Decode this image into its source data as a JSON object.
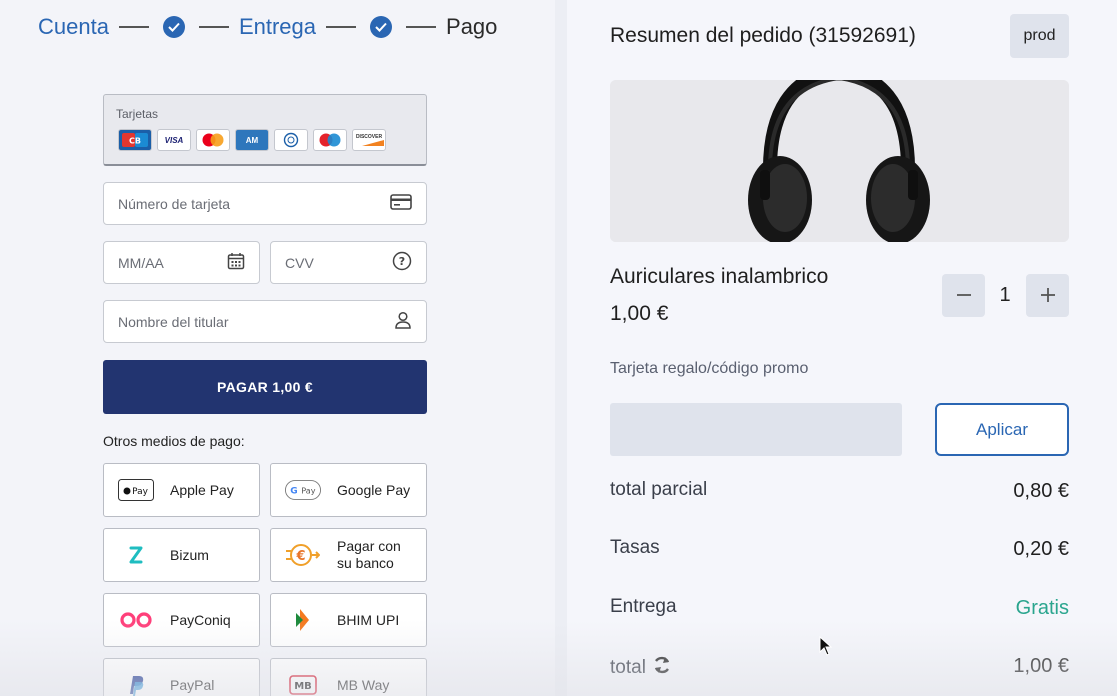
{
  "stepper": {
    "step1": "Cuenta",
    "step2": "Entrega",
    "step3": "Pago"
  },
  "payment": {
    "cards_title": "Tarjetas",
    "brands": [
      "CB",
      "VISA",
      "Mastercard",
      "AMEX",
      "Diners",
      "Maestro",
      "Discover"
    ],
    "card_number_placeholder": "Número de tarjeta",
    "expiry_placeholder": "MM/AA",
    "cvv_placeholder": "CVV",
    "holder_placeholder": "Nombre del titular",
    "pay_button": "PAGAR 1,00 €",
    "other_title": "Otros medios de pago:",
    "methods": [
      {
        "label": "Apple Pay",
        "icon": "apple-pay-icon"
      },
      {
        "label": "Google Pay",
        "icon": "google-pay-icon"
      },
      {
        "label": "Bizum",
        "icon": "bizum-icon"
      },
      {
        "label": "Pagar con su banco",
        "icon": "bank-transfer-icon"
      },
      {
        "label": "PayConiq",
        "icon": "payconiq-icon"
      },
      {
        "label": "BHIM UPI",
        "icon": "bhim-upi-icon"
      },
      {
        "label": "PayPal",
        "icon": "paypal-icon"
      },
      {
        "label": "MB Way",
        "icon": "mbway-icon"
      }
    ]
  },
  "summary": {
    "title": "Resumen del pedido (31592691)",
    "badge": "prod",
    "product_name": "Auriculares inalambrico",
    "product_price": "1,00 €",
    "quantity": "1",
    "promo_label": "Tarjeta regalo/código promo",
    "apply_button": "Aplicar",
    "subtotal_label": "total parcial",
    "subtotal_value": "0,80 €",
    "tax_label": "Tasas",
    "tax_value": "0,20 €",
    "delivery_label": "Entrega",
    "delivery_value": "Gratis",
    "total_label": "total",
    "total_value": "1,00 €"
  },
  "colors": {
    "accent": "#2a66b3",
    "pay_button": "#223470",
    "free": "#2aa58e"
  }
}
